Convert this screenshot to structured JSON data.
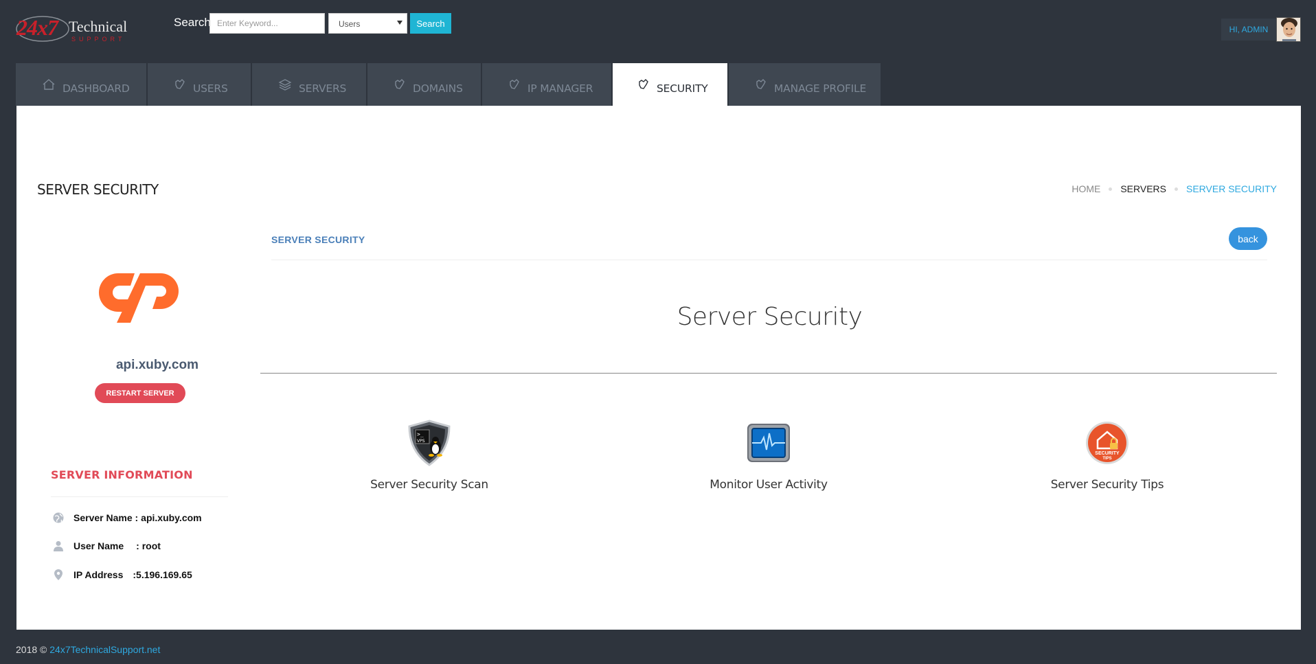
{
  "brand": {
    "logo_number": "24x7",
    "logo_word": "Technical",
    "logo_tagline": "SUPPORT"
  },
  "search": {
    "label": "Search",
    "placeholder": "Enter Keyword...",
    "select_value": "Users",
    "button_label": "Search"
  },
  "user": {
    "greeting": "HI, ADMIN"
  },
  "nav": {
    "tabs": [
      {
        "label": "DASHBOARD",
        "icon": "home-icon"
      },
      {
        "label": "USERS",
        "icon": "hand-icon"
      },
      {
        "label": "SERVERS",
        "icon": "layers-icon"
      },
      {
        "label": "DOMAINS",
        "icon": "hand-icon"
      },
      {
        "label": "IP MANAGER",
        "icon": "hand-icon"
      },
      {
        "label": "SECURITY",
        "icon": "hand-icon",
        "active": true
      },
      {
        "label": "MANAGE PROFILE",
        "icon": "hand-icon"
      }
    ]
  },
  "page": {
    "title": "SERVER SECURITY",
    "breadcrumb": [
      "HOME",
      "SERVERS",
      "SERVER SECURITY"
    ]
  },
  "server": {
    "hostname": "api.xuby.com",
    "restart_label": "RESTART SERVER",
    "info_title": "SERVER INFORMATION",
    "info": [
      {
        "key": "Server Name :",
        "value": "api.xuby.com",
        "icon": "globe-icon"
      },
      {
        "key": "User Name",
        "value": ": root",
        "icon": "user-icon"
      },
      {
        "key": "IP Address",
        "value": ":5.196.169.65",
        "icon": "map-pin-icon"
      }
    ]
  },
  "main": {
    "section_label": "SERVER SECURITY",
    "back_label": "back",
    "heading": "Server Security",
    "features": [
      {
        "label": "Server Security Scan",
        "icon": "vps-shield-icon"
      },
      {
        "label": "Monitor User Activity",
        "icon": "monitor-activity-icon"
      },
      {
        "label": "Server Security Tips",
        "icon": "security-tips-icon",
        "badge_text": "SECURITY TIPS"
      }
    ]
  },
  "footer": {
    "copyright": "2018 ©",
    "link": "24x7TechnicalSupport.net"
  },
  "colors": {
    "bg": "#2e343d",
    "accent": "#2fa9e0",
    "danger": "#e14a57",
    "cpanel": "#ff6c2c",
    "tab": "#3f4751"
  }
}
